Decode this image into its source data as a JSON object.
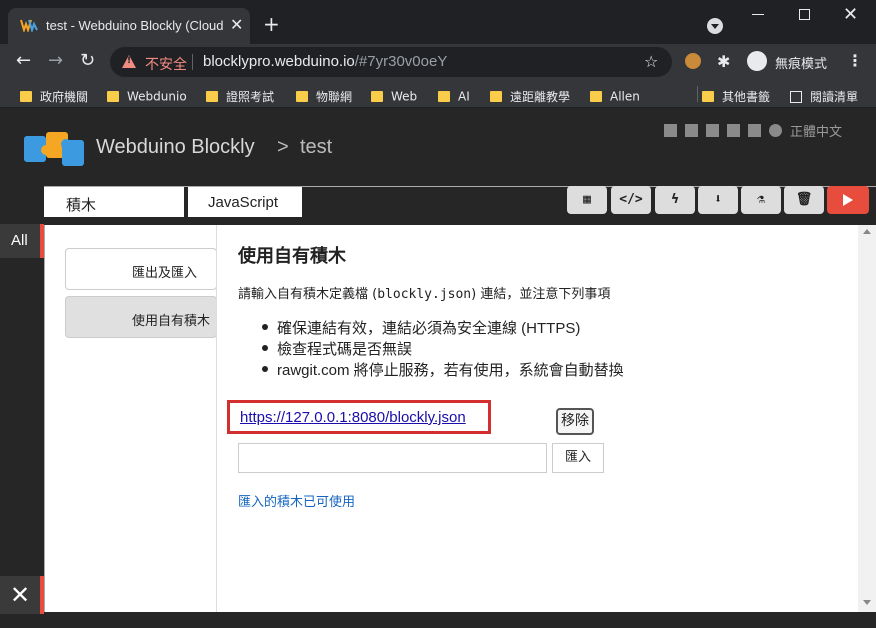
{
  "browser": {
    "tab_title": "test - Webduino Blockly (Cloud",
    "tab_close": "✕",
    "new_tab": "+",
    "security_label": "不安全",
    "url_host": "blocklypro.webduino.io",
    "url_rest": "/#7yr30v0oeY",
    "incognito_label": "無痕模式",
    "bookmarks": [
      {
        "label": "政府機關"
      },
      {
        "label": "Webdunio"
      },
      {
        "label": "證照考試"
      },
      {
        "label": "物聯網"
      },
      {
        "label": "Web"
      },
      {
        "label": "AI"
      },
      {
        "label": "遠距離教學"
      },
      {
        "label": "Allen"
      }
    ],
    "other_bookmarks": "其他書籤",
    "reading_list": "閱讀清單"
  },
  "app": {
    "title": "Webduino Blockly",
    "breadcrumb_sep": ">",
    "project": "test",
    "language": "正體中文",
    "tabs": {
      "blocks": "積木",
      "javascript": "JavaScript"
    },
    "category_all": "All",
    "close_symbol": "✕"
  },
  "toolbar": {
    "qr_label": "▦",
    "code_label": "</>",
    "flash_label": "ϟ",
    "save_label": "⬇",
    "lab_label": "⚗",
    "trash_label": "🗑"
  },
  "dialog": {
    "side_nav": [
      {
        "label": "匯出及匯入"
      },
      {
        "label": "使用自有積木"
      }
    ],
    "title": "使用自有積木",
    "desc_prefix": "請輸入自有積木定義檔 (",
    "desc_code": "blockly.json",
    "desc_suffix": ") 連結，並注意下列事項",
    "notes": [
      "確保連結有效，連結必須為安全連線 (HTTPS)",
      "檢查程式碼是否無誤",
      "rawgit.com 將停止服務，若有使用，系統會自動替換"
    ],
    "custom_url": "https://127.0.0.1:8080/blockly.json",
    "remove_button": "移除",
    "input_value": "",
    "import_button": "匯入",
    "status": "匯入的積木已可使用"
  },
  "colors": {
    "accent_red": "#e74c3c",
    "highlight_box": "#d32f2f",
    "link_blue": "#1a0dab",
    "status_blue": "#1565c0"
  }
}
